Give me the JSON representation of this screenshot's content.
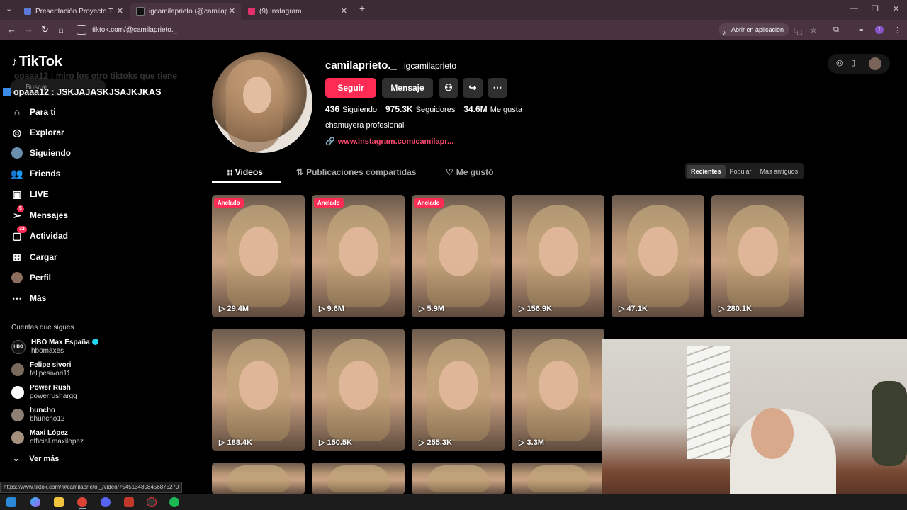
{
  "browser": {
    "tabs": [
      {
        "label": "Presentación Proyecto Trabajo",
        "color": "#5b7bd8"
      },
      {
        "label": "igcamilaprieto (@camilapr",
        "color": "#111111",
        "active": true
      },
      {
        "label": "(9) Instagram",
        "color": "#e1306c"
      }
    ],
    "new_tab": "+",
    "url": "tiktok.com/@camilaprieto._",
    "open_in_app": "Abrir en aplicación",
    "profile_letter": "f"
  },
  "sidebar": {
    "logo": "TikTok",
    "ghost_text": "opaaa12 : miro los otro tiktoks que tiene",
    "search_placeholder": "Buscar",
    "overlay": "opaaa12 : JSKJAJASKJSAJKJKAS",
    "nav": [
      {
        "label": "Para ti",
        "icon": "home-icon"
      },
      {
        "label": "Explorar",
        "icon": "compass-icon"
      },
      {
        "label": "Siguiendo",
        "icon": "following-icon"
      },
      {
        "label": "Friends",
        "icon": "friends-icon"
      },
      {
        "label": "LIVE",
        "icon": "live-icon"
      },
      {
        "label": "Mensajes",
        "icon": "messages-icon",
        "badge": "5"
      },
      {
        "label": "Actividad",
        "icon": "activity-icon",
        "badge": "32"
      },
      {
        "label": "Cargar",
        "icon": "upload-icon"
      },
      {
        "label": "Perfil",
        "icon": "profile-icon"
      },
      {
        "label": "Más",
        "icon": "more-icon"
      }
    ],
    "following_title": "Cuentas que sigues",
    "accounts": [
      {
        "name": "HBO Max España",
        "handle": "hbomaxes",
        "verified": true,
        "avatar": "HBO"
      },
      {
        "name": "Felipe sivori",
        "handle": "felipesivori11"
      },
      {
        "name": "Power Rush",
        "handle": "powerrushargg"
      },
      {
        "name": "huncho",
        "handle": "bhuncho12"
      },
      {
        "name": "Maxi López",
        "handle": "official.maxilopez"
      }
    ],
    "see_more": "Ver más",
    "status_url": "https://www.tiktok.com/@camilaprieto._/video/7545134808456875270"
  },
  "profile": {
    "username": "camilaprieto._",
    "nickname": "igcamilaprieto",
    "follow": "Seguir",
    "message": "Mensaje",
    "following_count": "436",
    "following_label": "Siguiendo",
    "followers_count": "975.3K",
    "followers_label": "Seguidores",
    "likes_count": "34.6M",
    "likes_label": "Me gusta",
    "bio": "chamuyera profesional",
    "link": "www.instagram.com/camilapr..."
  },
  "tabs": {
    "videos": "Videos",
    "reposts": "Publicaciones compartidas",
    "liked": "Me gustó"
  },
  "sort": {
    "recent": "Recientes",
    "popular": "Popular",
    "oldest": "Más antiguos"
  },
  "videos": [
    {
      "views": "29.4M",
      "pinned": "Anclado"
    },
    {
      "views": "9.6M",
      "pinned": "Anclado"
    },
    {
      "views": "5.9M",
      "pinned": "Anclado"
    },
    {
      "views": "156.9K"
    },
    {
      "views": "47.1K"
    },
    {
      "views": "280.1K"
    },
    {
      "views": "188.4K"
    },
    {
      "views": "150.5K"
    },
    {
      "views": "255.3K"
    },
    {
      "views": "3.3M"
    }
  ],
  "colors": {
    "accent": "#fe2c55",
    "link": "#fe4a6c"
  }
}
